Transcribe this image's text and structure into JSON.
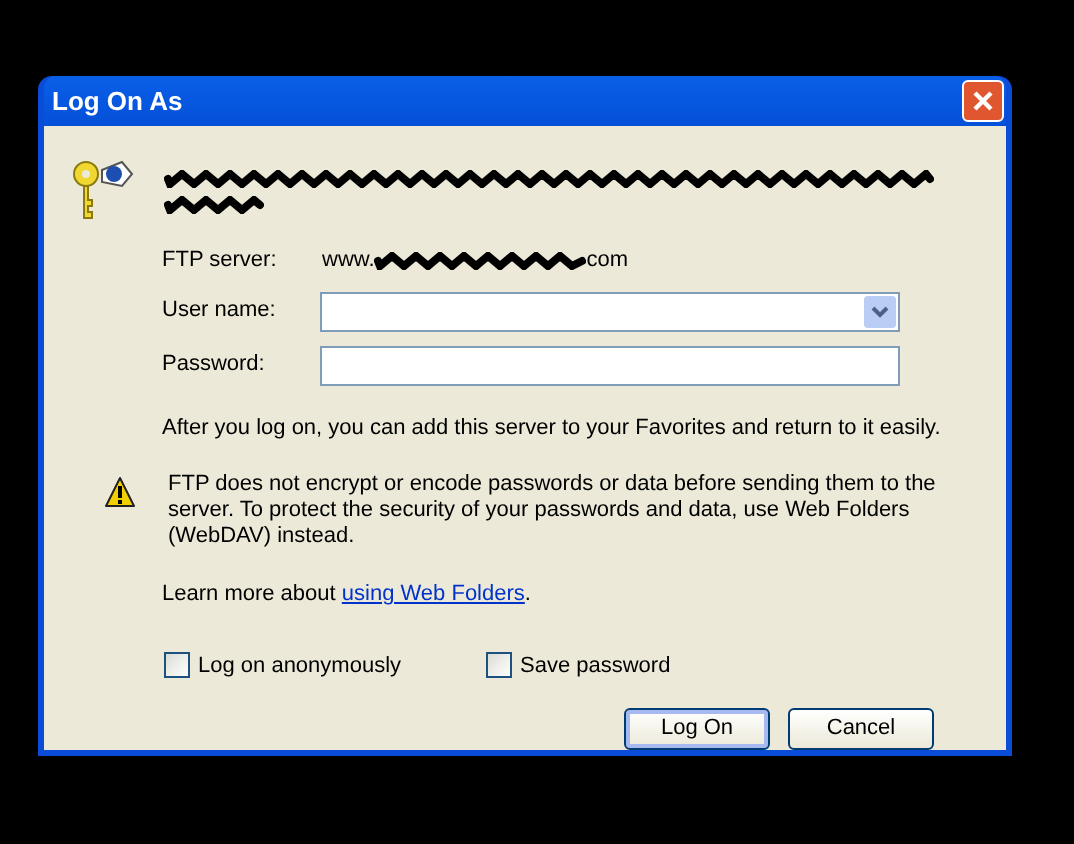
{
  "window": {
    "title": "Log On As"
  },
  "server": {
    "label": "FTP server:",
    "prefix": "www.",
    "suffix": "com"
  },
  "fields": [
    {
      "kind": "combo",
      "label": "User name:"
    },
    {
      "kind": "password",
      "label": "Password:"
    }
  ],
  "info": "After you log on, you can add this server to your Favorites and return to it easily.",
  "warning": "FTP does not encrypt or encode passwords or data before sending them to the server.  To protect the security of your passwords and data, use Web Folders (WebDAV) instead.",
  "learn_more": {
    "text": "Learn more about ",
    "link": "using Web Folders",
    "after": "."
  },
  "checkboxes": [
    {
      "label": "Log on anonymously",
      "checked": false
    },
    {
      "label": "Save password",
      "checked": false
    }
  ],
  "buttons": [
    {
      "label": "Log On",
      "default": true
    },
    {
      "label": "Cancel",
      "default": false
    }
  ]
}
